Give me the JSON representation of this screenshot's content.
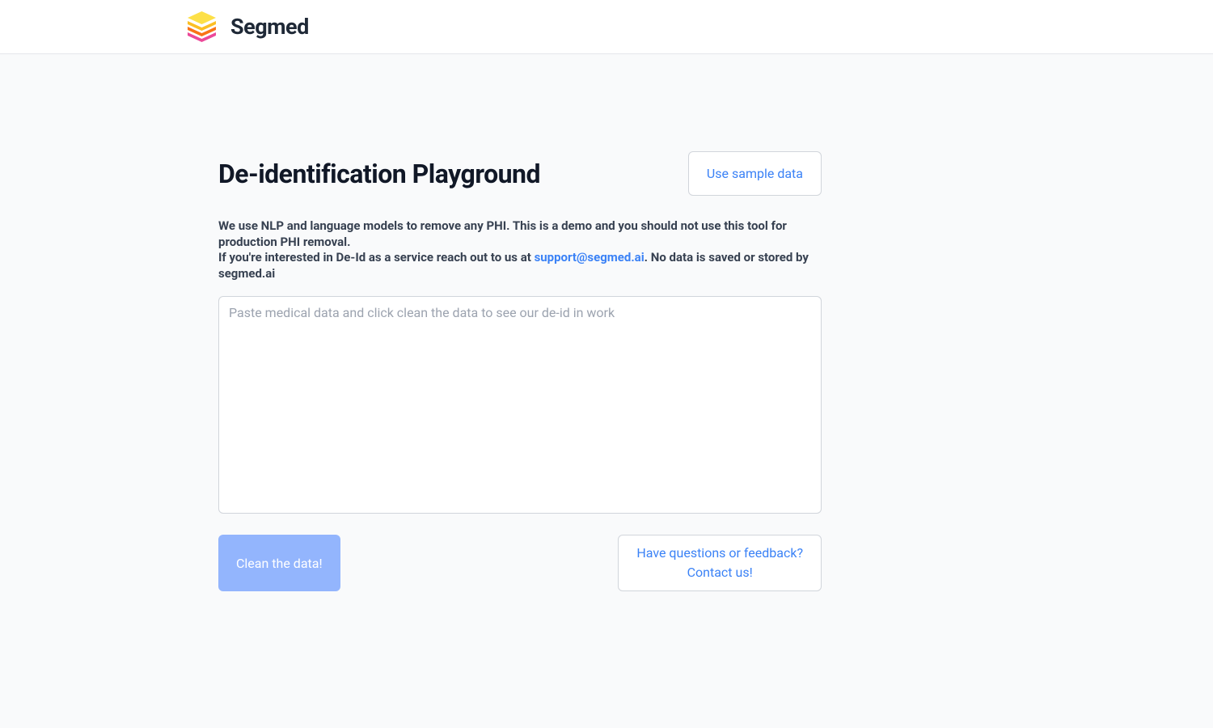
{
  "header": {
    "brand": "Segmed"
  },
  "main": {
    "title": "De-identification Playground",
    "sample_button_label": "Use sample data",
    "description_line1": "We use NLP and language models to remove any PHI. This is a demo and you should not use this tool for production PHI removal.",
    "description_line2_prefix": "If you're interested in De-Id as a service reach out to us at ",
    "support_email": "support@segmed.ai",
    "description_line2_suffix": ". No data is saved or stored by segmed.ai",
    "textarea_placeholder": "Paste medical data and click clean the data to see our de-id in work",
    "clean_button_label": "Clean the data!",
    "contact_button_line1": "Have questions or feedback?",
    "contact_button_line2": "Contact us!"
  }
}
